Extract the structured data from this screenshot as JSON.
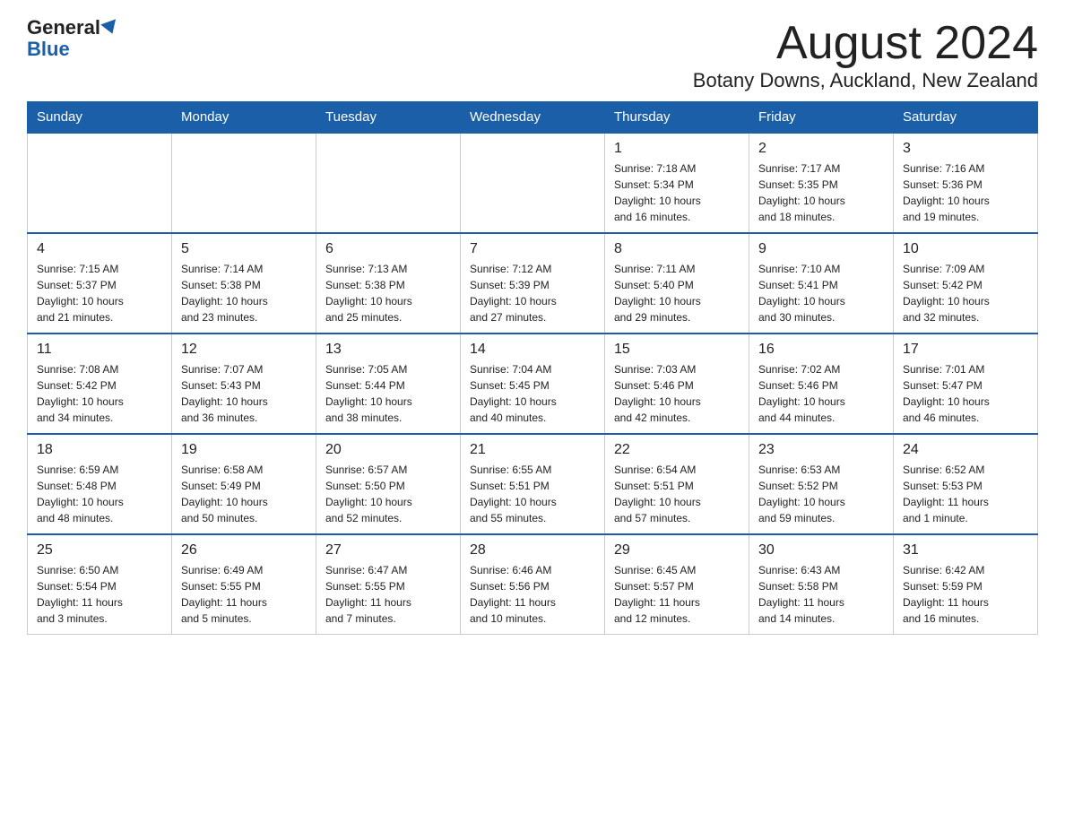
{
  "header": {
    "logo_general": "General",
    "logo_blue": "Blue",
    "month_title": "August 2024",
    "subtitle": "Botany Downs, Auckland, New Zealand"
  },
  "days_of_week": [
    "Sunday",
    "Monday",
    "Tuesday",
    "Wednesday",
    "Thursday",
    "Friday",
    "Saturday"
  ],
  "weeks": [
    [
      {
        "day": "",
        "info": ""
      },
      {
        "day": "",
        "info": ""
      },
      {
        "day": "",
        "info": ""
      },
      {
        "day": "",
        "info": ""
      },
      {
        "day": "1",
        "info": "Sunrise: 7:18 AM\nSunset: 5:34 PM\nDaylight: 10 hours\nand 16 minutes."
      },
      {
        "day": "2",
        "info": "Sunrise: 7:17 AM\nSunset: 5:35 PM\nDaylight: 10 hours\nand 18 minutes."
      },
      {
        "day": "3",
        "info": "Sunrise: 7:16 AM\nSunset: 5:36 PM\nDaylight: 10 hours\nand 19 minutes."
      }
    ],
    [
      {
        "day": "4",
        "info": "Sunrise: 7:15 AM\nSunset: 5:37 PM\nDaylight: 10 hours\nand 21 minutes."
      },
      {
        "day": "5",
        "info": "Sunrise: 7:14 AM\nSunset: 5:38 PM\nDaylight: 10 hours\nand 23 minutes."
      },
      {
        "day": "6",
        "info": "Sunrise: 7:13 AM\nSunset: 5:38 PM\nDaylight: 10 hours\nand 25 minutes."
      },
      {
        "day": "7",
        "info": "Sunrise: 7:12 AM\nSunset: 5:39 PM\nDaylight: 10 hours\nand 27 minutes."
      },
      {
        "day": "8",
        "info": "Sunrise: 7:11 AM\nSunset: 5:40 PM\nDaylight: 10 hours\nand 29 minutes."
      },
      {
        "day": "9",
        "info": "Sunrise: 7:10 AM\nSunset: 5:41 PM\nDaylight: 10 hours\nand 30 minutes."
      },
      {
        "day": "10",
        "info": "Sunrise: 7:09 AM\nSunset: 5:42 PM\nDaylight: 10 hours\nand 32 minutes."
      }
    ],
    [
      {
        "day": "11",
        "info": "Sunrise: 7:08 AM\nSunset: 5:42 PM\nDaylight: 10 hours\nand 34 minutes."
      },
      {
        "day": "12",
        "info": "Sunrise: 7:07 AM\nSunset: 5:43 PM\nDaylight: 10 hours\nand 36 minutes."
      },
      {
        "day": "13",
        "info": "Sunrise: 7:05 AM\nSunset: 5:44 PM\nDaylight: 10 hours\nand 38 minutes."
      },
      {
        "day": "14",
        "info": "Sunrise: 7:04 AM\nSunset: 5:45 PM\nDaylight: 10 hours\nand 40 minutes."
      },
      {
        "day": "15",
        "info": "Sunrise: 7:03 AM\nSunset: 5:46 PM\nDaylight: 10 hours\nand 42 minutes."
      },
      {
        "day": "16",
        "info": "Sunrise: 7:02 AM\nSunset: 5:46 PM\nDaylight: 10 hours\nand 44 minutes."
      },
      {
        "day": "17",
        "info": "Sunrise: 7:01 AM\nSunset: 5:47 PM\nDaylight: 10 hours\nand 46 minutes."
      }
    ],
    [
      {
        "day": "18",
        "info": "Sunrise: 6:59 AM\nSunset: 5:48 PM\nDaylight: 10 hours\nand 48 minutes."
      },
      {
        "day": "19",
        "info": "Sunrise: 6:58 AM\nSunset: 5:49 PM\nDaylight: 10 hours\nand 50 minutes."
      },
      {
        "day": "20",
        "info": "Sunrise: 6:57 AM\nSunset: 5:50 PM\nDaylight: 10 hours\nand 52 minutes."
      },
      {
        "day": "21",
        "info": "Sunrise: 6:55 AM\nSunset: 5:51 PM\nDaylight: 10 hours\nand 55 minutes."
      },
      {
        "day": "22",
        "info": "Sunrise: 6:54 AM\nSunset: 5:51 PM\nDaylight: 10 hours\nand 57 minutes."
      },
      {
        "day": "23",
        "info": "Sunrise: 6:53 AM\nSunset: 5:52 PM\nDaylight: 10 hours\nand 59 minutes."
      },
      {
        "day": "24",
        "info": "Sunrise: 6:52 AM\nSunset: 5:53 PM\nDaylight: 11 hours\nand 1 minute."
      }
    ],
    [
      {
        "day": "25",
        "info": "Sunrise: 6:50 AM\nSunset: 5:54 PM\nDaylight: 11 hours\nand 3 minutes."
      },
      {
        "day": "26",
        "info": "Sunrise: 6:49 AM\nSunset: 5:55 PM\nDaylight: 11 hours\nand 5 minutes."
      },
      {
        "day": "27",
        "info": "Sunrise: 6:47 AM\nSunset: 5:55 PM\nDaylight: 11 hours\nand 7 minutes."
      },
      {
        "day": "28",
        "info": "Sunrise: 6:46 AM\nSunset: 5:56 PM\nDaylight: 11 hours\nand 10 minutes."
      },
      {
        "day": "29",
        "info": "Sunrise: 6:45 AM\nSunset: 5:57 PM\nDaylight: 11 hours\nand 12 minutes."
      },
      {
        "day": "30",
        "info": "Sunrise: 6:43 AM\nSunset: 5:58 PM\nDaylight: 11 hours\nand 14 minutes."
      },
      {
        "day": "31",
        "info": "Sunrise: 6:42 AM\nSunset: 5:59 PM\nDaylight: 11 hours\nand 16 minutes."
      }
    ]
  ]
}
